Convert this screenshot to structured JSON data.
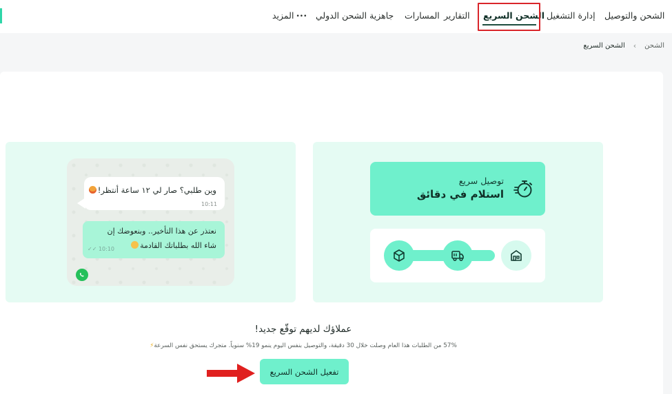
{
  "nav": {
    "items": [
      {
        "label": "الشحن والتوصيل"
      },
      {
        "label": "إدارة التشغيل"
      },
      {
        "label": "الشحن السريع",
        "active": true
      },
      {
        "label": "التقارير"
      },
      {
        "label": "المسارات"
      },
      {
        "label": "جاهزية الشحن الدولي"
      },
      {
        "label": "المزيد"
      }
    ]
  },
  "breadcrumb": {
    "root": "الشحن",
    "current": "الشحن السريع"
  },
  "chat": {
    "incoming": {
      "text": "وين طلبي؟ صار لي ١٢ ساعة أنتظر!",
      "time": "10:11"
    },
    "outgoing": {
      "line1": "نعتذر عن هذا التأخير.. وبنعوضك إن",
      "line2": "شاء الله بطلباتك القادمة",
      "time": "10:10"
    }
  },
  "feature": {
    "subtitle": "توصيل سريع",
    "title": "استلام في دقائق"
  },
  "headline": "عملاؤك لديهم توقّع جديد!",
  "description": "57% من الطلبات هذا العام وصلت خلال 30 دقيقة، والتوصيل بنفس اليوم ينمو 19% سنوياً. متجرك يستحق نفس السرعة",
  "cta": {
    "label": "تفعيل الشحن السريع"
  },
  "colors": {
    "accent": "#6ff0cc",
    "card_bg": "#e5fbf3",
    "highlight": "#d9252a"
  }
}
